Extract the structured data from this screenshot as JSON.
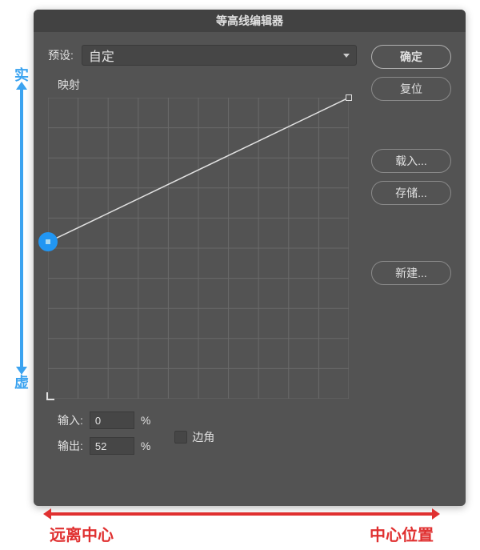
{
  "dialog": {
    "title": "等高线编辑器",
    "preset_label": "预设:",
    "preset_value": "自定",
    "mapping_label": "映射",
    "input_label": "输入:",
    "input_value": "0",
    "output_label": "输出:",
    "output_value": "52",
    "percent": "%",
    "corner_label": "边角"
  },
  "buttons": {
    "ok": "确定",
    "reset": "复位",
    "load": "载入...",
    "save": "存储...",
    "new": "新建..."
  },
  "annotations": {
    "top": "实",
    "bottom": "虚",
    "left": "远离中心",
    "right": "中心位置"
  },
  "chart_data": {
    "type": "line",
    "title": "映射",
    "xlabel": "输入",
    "ylabel": "输出",
    "xlim": [
      0,
      100
    ],
    "ylim": [
      0,
      100
    ],
    "points": [
      {
        "x": 0,
        "y": 52,
        "selected": true
      },
      {
        "x": 100,
        "y": 100
      }
    ],
    "grid": true
  }
}
